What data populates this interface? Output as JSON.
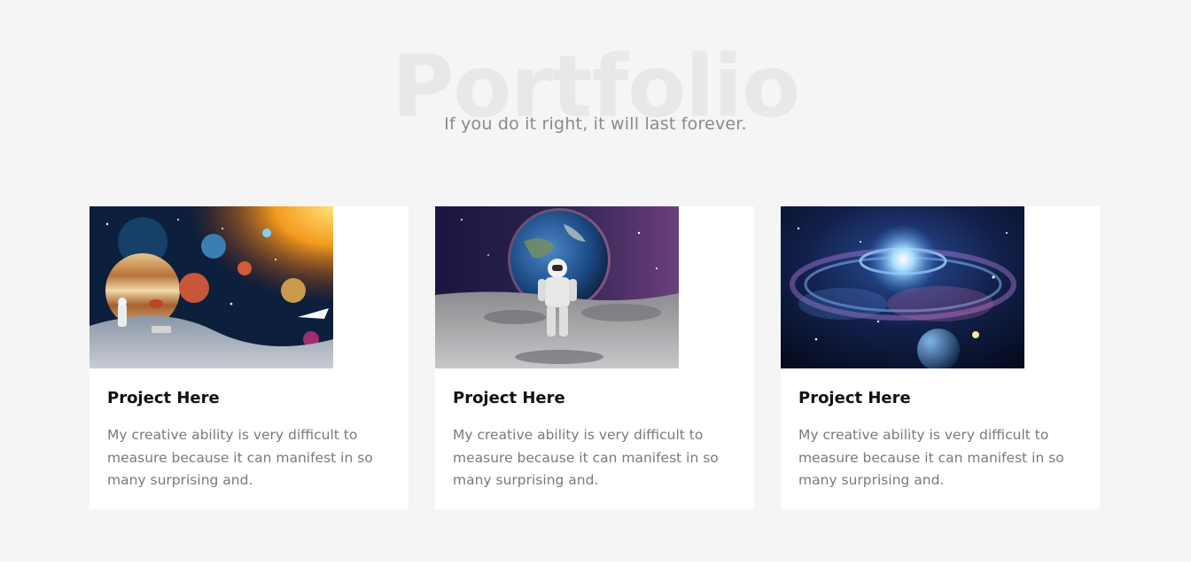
{
  "header": {
    "background_title": "Portfolio",
    "subtitle": "If you do it right, it will last forever."
  },
  "projects": [
    {
      "title": "Project Here",
      "description": "My creative ability is very difficult to measure because it can manifest in so many surprising and.",
      "image": "space-planets-collage-image"
    },
    {
      "title": "Project Here",
      "description": "My creative ability is very difficult to measure because it can manifest in so many surprising and.",
      "image": "astronaut-on-moon-image"
    },
    {
      "title": "Project Here",
      "description": "My creative ability is very difficult to measure because it can manifest in so many surprising and.",
      "image": "galaxy-nebula-image"
    }
  ],
  "colors": {
    "section_background": "#f5f5f5",
    "card_background": "#ffffff",
    "title_color": "#111111",
    "text_color": "#7a7a7a",
    "background_title_color": "#e8e8ea"
  }
}
